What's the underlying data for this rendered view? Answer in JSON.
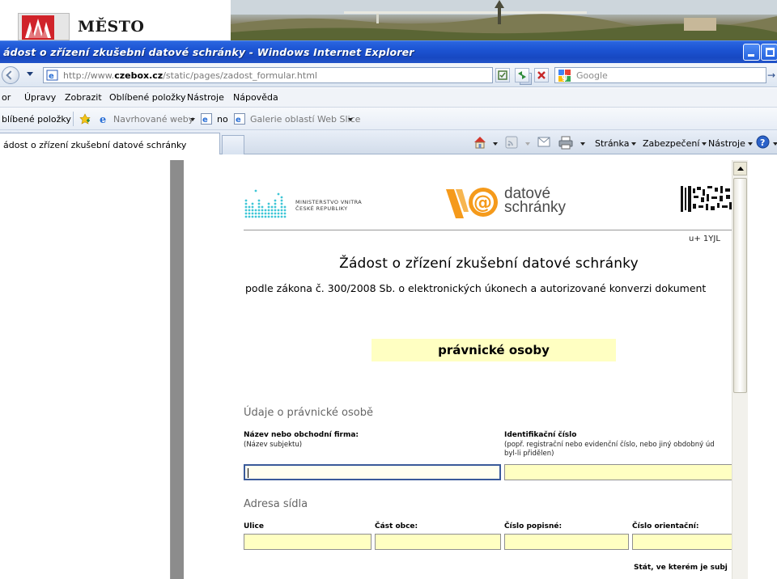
{
  "site": {
    "name": "MĚSTO"
  },
  "window": {
    "title": "ádost o zřízení zkušební datové schránky - Windows Internet Explorer"
  },
  "address": {
    "url_prefix": "http://www.",
    "url_domain": "czebox.cz",
    "url_path": "/static/pages/zadost_formular.html",
    "search_placeholder": "Google"
  },
  "menu": {
    "items": [
      "or",
      "Úpravy",
      "Zobrazit",
      "Oblíbené položky",
      "Nástroje",
      "Nápověda"
    ]
  },
  "favorites": {
    "label": "blíbené položky",
    "suggested": "Navrhované weby",
    "no": "no",
    "gallery": "Galerie oblastí Web Slice"
  },
  "tabs": {
    "active_title": "ádost o zřízení zkušební datové schránky"
  },
  "commands": {
    "page": "Stránka",
    "security": "Zabezpečení",
    "tools": "Nástroje"
  },
  "document": {
    "ministry_line1": "MINISTERSTVO VNITRA",
    "ministry_line2": "ČESKÉ REPUBLIKY",
    "ds_line1": "datové",
    "ds_line2": "schránky",
    "barcode_text": "u+ 1YJL",
    "title": "Žádost o zřízení zkušební datové schránky",
    "subtitle": "podle zákona č. 300/2008 Sb. o elektronických úkonech a autorizované konverzi dokument",
    "entity_type": "právnické osoby",
    "section1": "Údaje o právnické osobě",
    "name_label": "Název nebo obchodní firma:",
    "name_hint": "(Název subjektu)",
    "id_label": "Identifikační číslo",
    "id_hint_line1": "(popř. registrační nebo evidenční číslo, nebo jiný obdobný úd",
    "id_hint_line2": "byl-li přidělen)",
    "section2": "Adresa sídla",
    "street_label": "Ulice",
    "district_label": "Část obce:",
    "house_no_label": "Číslo popisné:",
    "orient_no_label": "Číslo orientační:",
    "state_label": "Stát, ve kterém je subj"
  },
  "colors": {
    "field_fill": "#ffffc2",
    "title_bar": "#1d55d4",
    "ds_orange": "#f59a1b"
  }
}
